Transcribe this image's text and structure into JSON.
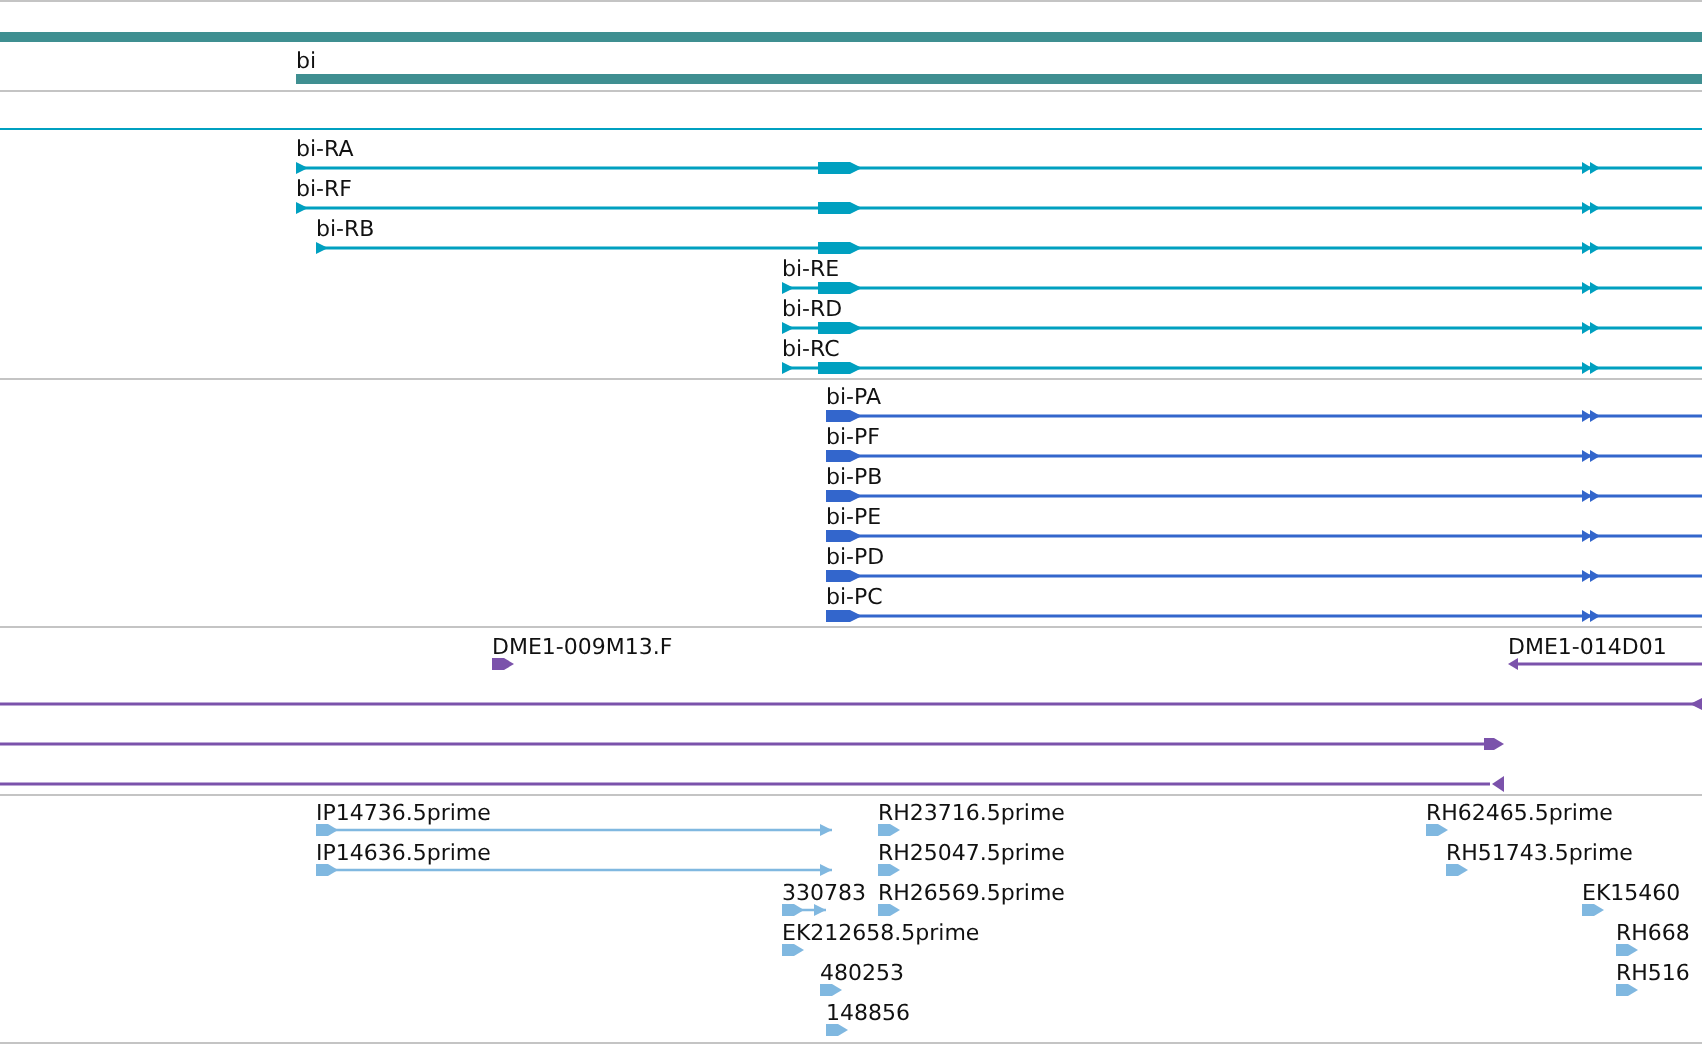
{
  "tracks": [
    {
      "kind": "gene",
      "features": [
        {
          "label": "bi"
        }
      ]
    },
    {
      "kind": "transcript",
      "features": [
        {
          "label": "bi-RA"
        },
        {
          "label": "bi-RF"
        },
        {
          "label": "bi-RB"
        },
        {
          "label": "bi-RE"
        },
        {
          "label": "bi-RD"
        },
        {
          "label": "bi-RC"
        }
      ]
    },
    {
      "kind": "protein",
      "features": [
        {
          "label": "bi-PA"
        },
        {
          "label": "bi-PF"
        },
        {
          "label": "bi-PB"
        },
        {
          "label": "bi-PE"
        },
        {
          "label": "bi-PD"
        },
        {
          "label": "bi-PC"
        }
      ]
    },
    {
      "kind": "clone",
      "features": [
        {
          "label": "DME1-009M13.F"
        },
        {
          "label": "DME1-014D01"
        }
      ]
    },
    {
      "kind": "est",
      "features": [
        {
          "label": "IP14736.5prime"
        },
        {
          "label": "RH23716.5prime"
        },
        {
          "label": "RH62465.5prime"
        },
        {
          "label": "IP14636.5prime"
        },
        {
          "label": "RH25047.5prime"
        },
        {
          "label": "RH51743.5prime"
        },
        {
          "label": "330783"
        },
        {
          "label": "RH26569.5prime"
        },
        {
          "label": "EK15460"
        },
        {
          "label": "EK212658.5prime"
        },
        {
          "label": "RH668"
        },
        {
          "label": "480253"
        },
        {
          "label": "RH516"
        },
        {
          "label": "148856"
        }
      ]
    }
  ]
}
